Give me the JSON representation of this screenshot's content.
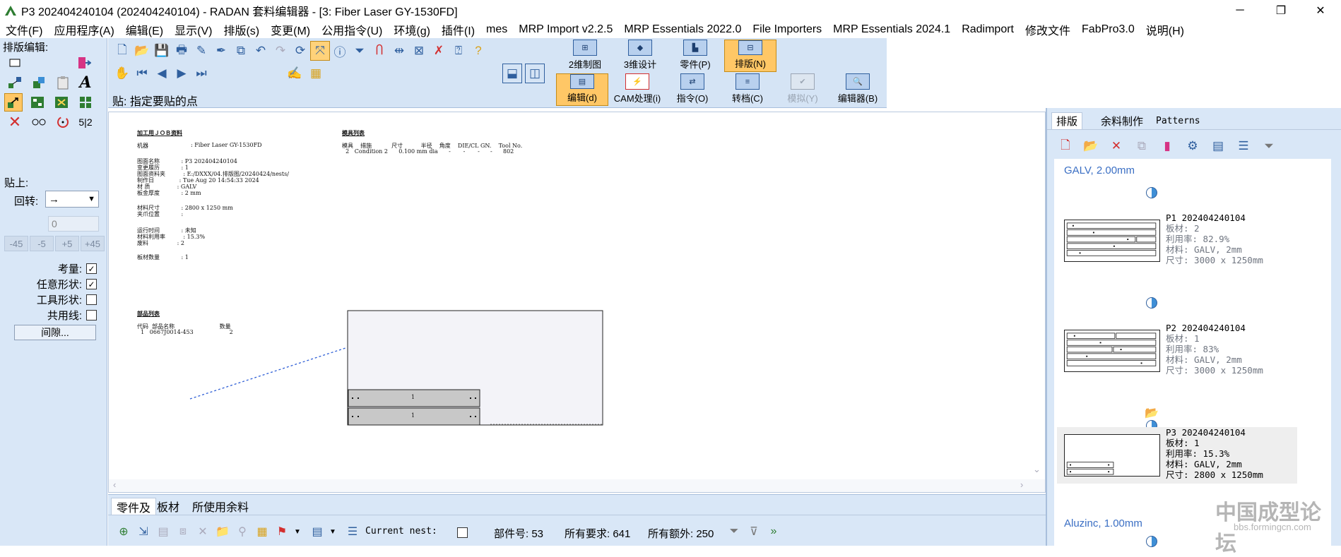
{
  "window": {
    "title": "P3 202404240104 (202404240104) - RADAN 套料编辑器 - [3: Fiber Laser GY-1530FD]",
    "minimize": "─",
    "maximize": "❐",
    "close": "✕"
  },
  "menu": [
    "文件(F)",
    "应用程序(A)",
    "编辑(E)",
    "显示(V)",
    "排版(s)",
    "变更(M)",
    "公用指令(U)",
    "环境(g)",
    "插件(I)",
    "mes",
    "MRP Import v2.2.5",
    "MRP Essentials 2022.0",
    "File Importers",
    "MRP Essentials 2024.1",
    "Radimport",
    "修改文件",
    "FabPro3.0",
    "说明(H)"
  ],
  "left_panel": {
    "title": "排版编辑:",
    "paste_label": "贴上:",
    "rotate_label": "回转:",
    "rotate_value": "→",
    "angle_value": "0",
    "angle_buttons": [
      "-45",
      "-5",
      "+5",
      "+45"
    ],
    "options": [
      {
        "label": "考量:",
        "checked": true
      },
      {
        "label": "任意形状:",
        "checked": true
      },
      {
        "label": "工具形状:",
        "checked": false
      },
      {
        "label": "共用线:",
        "checked": false
      }
    ],
    "gap_button": "间隙...",
    "tool_text_a": "A",
    "tool_text_52": "5|2"
  },
  "toolbar": {
    "hint": "贴:  指定要贴的点"
  },
  "modes": {
    "row1": [
      {
        "label": "2维制图",
        "icon": "drawing-2d-icon",
        "selected": false
      },
      {
        "label": "3维设计",
        "icon": "design-3d-icon",
        "selected": false
      },
      {
        "label": "零件(P)",
        "icon": "part-icon",
        "selected": false
      },
      {
        "label": "排版(N)",
        "icon": "nest-icon",
        "selected": true
      }
    ],
    "row2": [
      {
        "label": "编辑(d)",
        "icon": "edit-icon",
        "selected": true,
        "disabled": false
      },
      {
        "label": "CAM处理(i)",
        "icon": "cam-icon",
        "selected": false,
        "disabled": false
      },
      {
        "label": "指令(O)",
        "icon": "command-icon",
        "selected": false,
        "disabled": false
      },
      {
        "label": "转档(C)",
        "icon": "convert-icon",
        "selected": false,
        "disabled": false
      },
      {
        "label": "模拟(Y)",
        "icon": "simulate-icon",
        "selected": false,
        "disabled": true
      },
      {
        "label": "编辑器(B)",
        "icon": "editor-icon",
        "selected": false,
        "disabled": false
      }
    ]
  },
  "report": {
    "job_title": "加工用ＪＯＢ资料",
    "machine_label": "机器",
    "machine_value": ": Fiber Laser GY-1530FD",
    "lines": [
      "图面名称            : P3 202404240104",
      "变更履历            : 1",
      "图面资料夹          : E:/DXXX/04.排版图/20240424/nests/",
      "制作日              : Tue Aug 20 14:54:33 2024",
      "材 质               : GALV",
      "板金厚度            : 2 mm"
    ],
    "lines2": [
      "材料尺寸            : 2800 x 1250 mm",
      "夹爪位置            :"
    ],
    "lines3": [
      "运行时间            : 未知",
      "材料利用率          : 15.3%",
      "废料                : 2"
    ],
    "sheets_line": "板材数量            : 1",
    "tools_title": "模具列表",
    "tools_header": "模具    措施           尺寸          半径    角度    DIE/CL GN.    Tool No.",
    "tools_row": "  2   Condition 2      0.100 mm dia      -       -       -      -      802",
    "parts_title": "部品列表",
    "parts_header": "代码  部品名称                         数量",
    "parts_row": "  1   0667J0014-453                    2",
    "part_label": "1"
  },
  "bottom": {
    "tabs": [
      "零件及",
      "板材",
      "所使用余料"
    ],
    "current_nest_label": "Current nest:",
    "parts_no": "部件号:  53",
    "required": "所有要求:  641",
    "extra": "所有额外:  250"
  },
  "right_panel": {
    "tabs": [
      "排版",
      "余料制作",
      "Patterns"
    ],
    "groups": [
      {
        "title": "GALV, 2.00mm"
      },
      {
        "title": "Aluzinc, 1.00mm"
      }
    ],
    "nests": [
      {
        "name": "P1 202404240104",
        "sheets": "板材: 2",
        "util": "利用率: 82.9%",
        "material": "材料: GALV, 2mm",
        "size": "尺寸: 3000 x 1250mm",
        "selected": false
      },
      {
        "name": "P2 202404240104",
        "sheets": "板材: 1",
        "util": "利用率: 83%",
        "material": "材料: GALV, 2mm",
        "size": "尺寸: 3000 x 1250mm",
        "selected": false
      },
      {
        "name": "P3 202404240104",
        "sheets": "板材: 1",
        "util": "利用率: 15.3%",
        "material": "材料: GALV, 2mm",
        "size": "尺寸: 2800 x 1250mm",
        "selected": true
      }
    ]
  },
  "watermark": {
    "cn": "中国成型论坛",
    "url": "bbs.formingcn.com"
  }
}
